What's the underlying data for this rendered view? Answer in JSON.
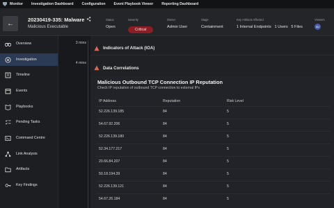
{
  "topnav": [
    "Monitor",
    "Investigation Dashboard",
    "Configuration",
    "Event Playbook Viewer",
    "Reporting Dashboard"
  ],
  "case": {
    "title": "20230419-335: Malware",
    "subtitle": "Malicious Executable"
  },
  "meta": {
    "status_label": "Status",
    "status": "Open",
    "severity_label": "Severity",
    "severity": "Critical",
    "owner_label": "Owner",
    "owner": "Admin User",
    "stage_label": "Stage",
    "stage": "Containment",
    "artifacts_label": "Key Artifacts Affected",
    "endpoints": "1 Internal Endpoints",
    "users": "1 Users",
    "files": "5 Files",
    "viewers_label": "Viewers",
    "viewer_initials": "AU"
  },
  "colors": {
    "accent_active": "#2c3b55",
    "critical": "#8a1e24",
    "background": "#1b1d21"
  },
  "sidebar": [
    {
      "label": "Overview",
      "icon": "binoculars-icon"
    },
    {
      "label": "Investigation",
      "icon": "target-icon",
      "active": true
    },
    {
      "label": "Timeline",
      "icon": "timeline-icon"
    },
    {
      "label": "Events",
      "icon": "calendar-icon"
    },
    {
      "label": "Playbooks",
      "icon": "book-icon"
    },
    {
      "label": "Pending Tasks",
      "icon": "checklist-icon"
    },
    {
      "label": "Command Centre",
      "icon": "terminal-icon"
    },
    {
      "label": "Link Analysis",
      "icon": "network-icon"
    },
    {
      "label": "Artifacts",
      "icon": "folder-icon"
    },
    {
      "label": "Key Findings",
      "icon": "key-icon"
    }
  ],
  "timeline": {
    "t1": "3 mins",
    "t2": "4 mins"
  },
  "sections": {
    "ioa": "Indicators of Attack (IOA)",
    "correlations": "Data Correlations"
  },
  "panel": {
    "title": "Malicious Outbound TCP Connection IP Reputation",
    "subtitle": "Check IP reputation of outbound TCP connection to external IPs"
  },
  "table": {
    "headers": [
      "IP Address",
      "Reputation",
      "Risk Level"
    ],
    "rows": [
      [
        "52.226.139.185",
        "84",
        "5"
      ],
      [
        "54.67.92.206",
        "84",
        "5"
      ],
      [
        "52.226.139.180",
        "84",
        "5"
      ],
      [
        "52.34.177.217",
        "84",
        "5"
      ],
      [
        "20.66.84.207",
        "84",
        "5"
      ],
      [
        "50.18.194.39",
        "84",
        "5"
      ],
      [
        "52.226.139.121",
        "84",
        "5"
      ],
      [
        "54.67.26.184",
        "84",
        "5"
      ]
    ]
  }
}
